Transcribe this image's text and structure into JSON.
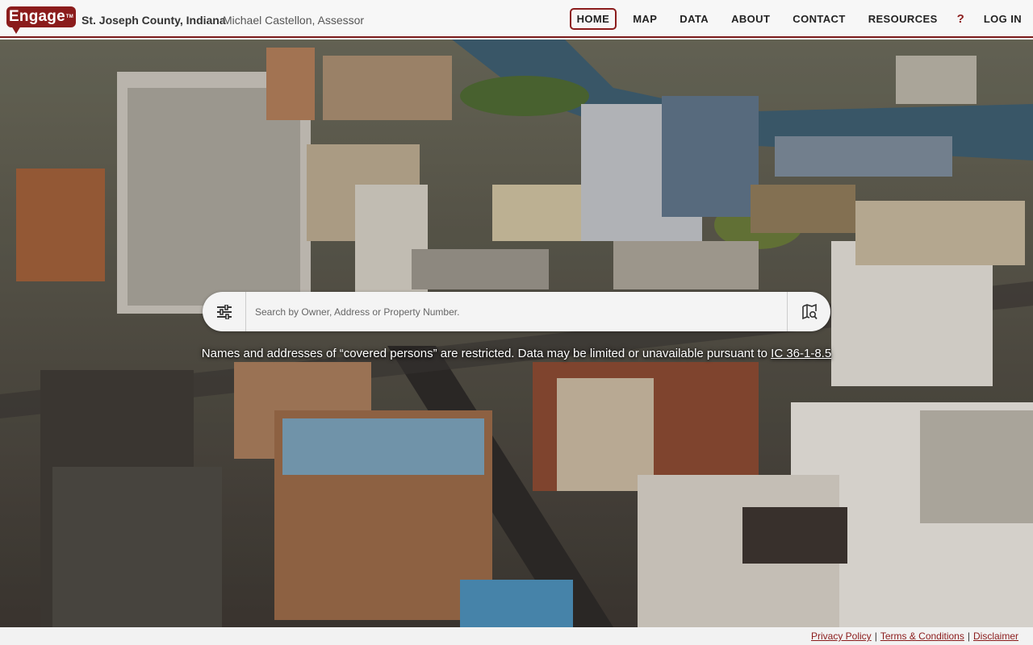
{
  "header": {
    "logo_text": "Engage",
    "logo_tm": "TM",
    "county": "St. Joseph County, Indiana",
    "assessor": "Michael Castellon, Assessor"
  },
  "nav": {
    "home": "HOME",
    "map": "MAP",
    "data": "DATA",
    "about": "ABOUT",
    "contact": "CONTACT",
    "resources": "RESOURCES",
    "help": "?",
    "login": "LOG IN"
  },
  "search": {
    "placeholder": "Search by Owner, Address or Property Number.",
    "filter_icon": "sliders-icon",
    "map_icon": "map-search-icon"
  },
  "notice": {
    "text": "Names and addresses of “covered persons” are restricted. Data may be limited or unavailable pursuant to ",
    "link": "IC 36-1-8.5"
  },
  "footer": {
    "privacy": "Privacy Policy",
    "terms": "Terms & Conditions",
    "disclaimer": "Disclaimer",
    "separator": "|"
  },
  "colors": {
    "accent": "#8b1c1c",
    "header_bg": "#f7f7f7"
  }
}
